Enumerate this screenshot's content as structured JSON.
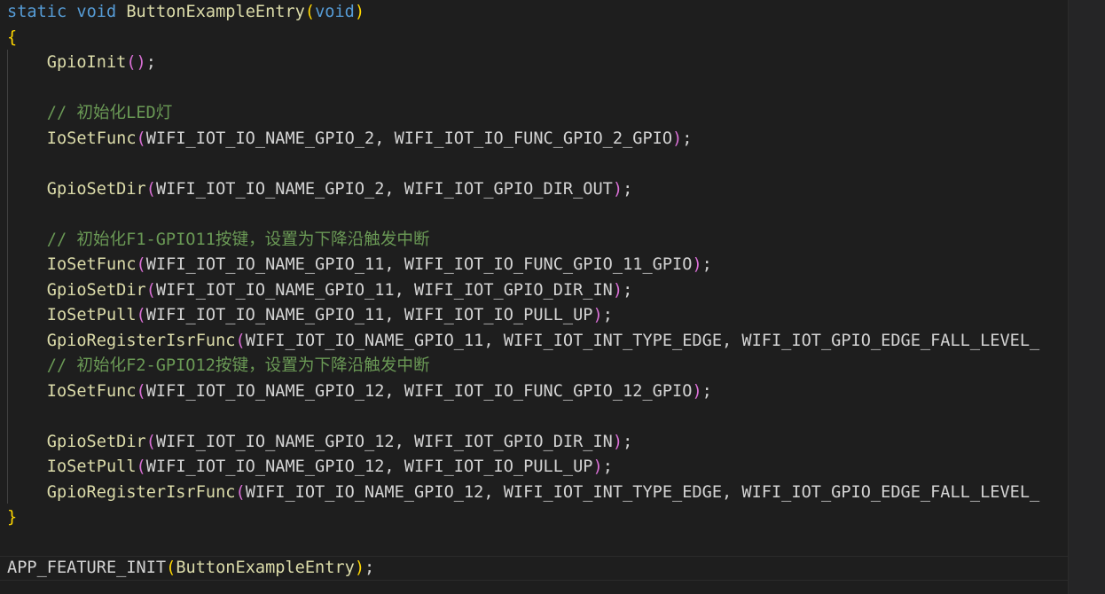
{
  "editor": {
    "lines": [
      [
        {
          "t": "static",
          "c": "kw"
        },
        {
          "t": " ",
          "c": "id"
        },
        {
          "t": "void",
          "c": "kw"
        },
        {
          "t": " ",
          "c": "id"
        },
        {
          "t": "ButtonExampleEntry",
          "c": "fn"
        },
        {
          "t": "(",
          "c": "p1"
        },
        {
          "t": "void",
          "c": "kw"
        },
        {
          "t": ")",
          "c": "p1"
        }
      ],
      [
        {
          "t": "{",
          "c": "p1"
        }
      ],
      [
        {
          "t": "    ",
          "c": "id"
        },
        {
          "t": "GpioInit",
          "c": "fn"
        },
        {
          "t": "()",
          "c": "p2"
        },
        {
          "t": ";",
          "c": "id"
        }
      ],
      [],
      [
        {
          "t": "    // 初始化LED灯",
          "c": "cm"
        }
      ],
      [
        {
          "t": "    ",
          "c": "id"
        },
        {
          "t": "IoSetFunc",
          "c": "fn"
        },
        {
          "t": "(",
          "c": "p2"
        },
        {
          "t": "WIFI_IOT_IO_NAME_GPIO_2, WIFI_IOT_IO_FUNC_GPIO_2_GPIO",
          "c": "id"
        },
        {
          "t": ")",
          "c": "p2"
        },
        {
          "t": ";",
          "c": "id"
        }
      ],
      [],
      [
        {
          "t": "    ",
          "c": "id"
        },
        {
          "t": "GpioSetDir",
          "c": "fn"
        },
        {
          "t": "(",
          "c": "p2"
        },
        {
          "t": "WIFI_IOT_IO_NAME_GPIO_2, WIFI_IOT_GPIO_DIR_OUT",
          "c": "id"
        },
        {
          "t": ")",
          "c": "p2"
        },
        {
          "t": ";",
          "c": "id"
        }
      ],
      [],
      [
        {
          "t": "    // 初始化F1-GPIO11按键，设置为下降沿触发中断",
          "c": "cm"
        }
      ],
      [
        {
          "t": "    ",
          "c": "id"
        },
        {
          "t": "IoSetFunc",
          "c": "fn"
        },
        {
          "t": "(",
          "c": "p2"
        },
        {
          "t": "WIFI_IOT_IO_NAME_GPIO_11, WIFI_IOT_IO_FUNC_GPIO_11_GPIO",
          "c": "id"
        },
        {
          "t": ")",
          "c": "p2"
        },
        {
          "t": ";",
          "c": "id"
        }
      ],
      [
        {
          "t": "    ",
          "c": "id"
        },
        {
          "t": "GpioSetDir",
          "c": "fn"
        },
        {
          "t": "(",
          "c": "p2"
        },
        {
          "t": "WIFI_IOT_IO_NAME_GPIO_11, WIFI_IOT_GPIO_DIR_IN",
          "c": "id"
        },
        {
          "t": ")",
          "c": "p2"
        },
        {
          "t": ";",
          "c": "id"
        }
      ],
      [
        {
          "t": "    ",
          "c": "id"
        },
        {
          "t": "IoSetPull",
          "c": "fn"
        },
        {
          "t": "(",
          "c": "p2"
        },
        {
          "t": "WIFI_IOT_IO_NAME_GPIO_11, WIFI_IOT_IO_PULL_UP",
          "c": "id"
        },
        {
          "t": ")",
          "c": "p2"
        },
        {
          "t": ";",
          "c": "id"
        }
      ],
      [
        {
          "t": "    ",
          "c": "id"
        },
        {
          "t": "GpioRegisterIsrFunc",
          "c": "fn"
        },
        {
          "t": "(",
          "c": "p2"
        },
        {
          "t": "WIFI_IOT_IO_NAME_GPIO_11, WIFI_IOT_INT_TYPE_EDGE, WIFI_IOT_GPIO_EDGE_FALL_LEVEL_",
          "c": "id"
        }
      ],
      [
        {
          "t": "    // 初始化F2-GPIO12按键，设置为下降沿触发中断",
          "c": "cm"
        }
      ],
      [
        {
          "t": "    ",
          "c": "id"
        },
        {
          "t": "IoSetFunc",
          "c": "fn"
        },
        {
          "t": "(",
          "c": "p2"
        },
        {
          "t": "WIFI_IOT_IO_NAME_GPIO_12, WIFI_IOT_IO_FUNC_GPIO_12_GPIO",
          "c": "id"
        },
        {
          "t": ")",
          "c": "p2"
        },
        {
          "t": ";",
          "c": "id"
        }
      ],
      [],
      [
        {
          "t": "    ",
          "c": "id"
        },
        {
          "t": "GpioSetDir",
          "c": "fn"
        },
        {
          "t": "(",
          "c": "p2"
        },
        {
          "t": "WIFI_IOT_IO_NAME_GPIO_12, WIFI_IOT_GPIO_DIR_IN",
          "c": "id"
        },
        {
          "t": ")",
          "c": "p2"
        },
        {
          "t": ";",
          "c": "id"
        }
      ],
      [
        {
          "t": "    ",
          "c": "id"
        },
        {
          "t": "IoSetPull",
          "c": "fn"
        },
        {
          "t": "(",
          "c": "p2"
        },
        {
          "t": "WIFI_IOT_IO_NAME_GPIO_12, WIFI_IOT_IO_PULL_UP",
          "c": "id"
        },
        {
          "t": ")",
          "c": "p2"
        },
        {
          "t": ";",
          "c": "id"
        }
      ],
      [
        {
          "t": "    ",
          "c": "id"
        },
        {
          "t": "GpioRegisterIsrFunc",
          "c": "fn"
        },
        {
          "t": "(",
          "c": "p2"
        },
        {
          "t": "WIFI_IOT_IO_NAME_GPIO_12, WIFI_IOT_INT_TYPE_EDGE, WIFI_IOT_GPIO_EDGE_FALL_LEVEL_",
          "c": "id"
        }
      ],
      [
        {
          "t": "}",
          "c": "p1"
        }
      ],
      [],
      [
        {
          "t": "APP_FEATURE_INIT",
          "c": "id"
        },
        {
          "t": "(",
          "c": "p1"
        },
        {
          "t": "ButtonExampleEntry",
          "c": "fn"
        },
        {
          "t": ")",
          "c": "p1"
        },
        {
          "t": ";",
          "c": "id"
        }
      ]
    ]
  },
  "colors": {
    "background": "#1e1e1e",
    "keyword": "#569cd6",
    "function": "#dcdcaa",
    "bracket_level1": "#ffd700",
    "bracket_level2": "#da70d6",
    "identifier": "#d4d4d4",
    "comment": "#6a9955"
  }
}
